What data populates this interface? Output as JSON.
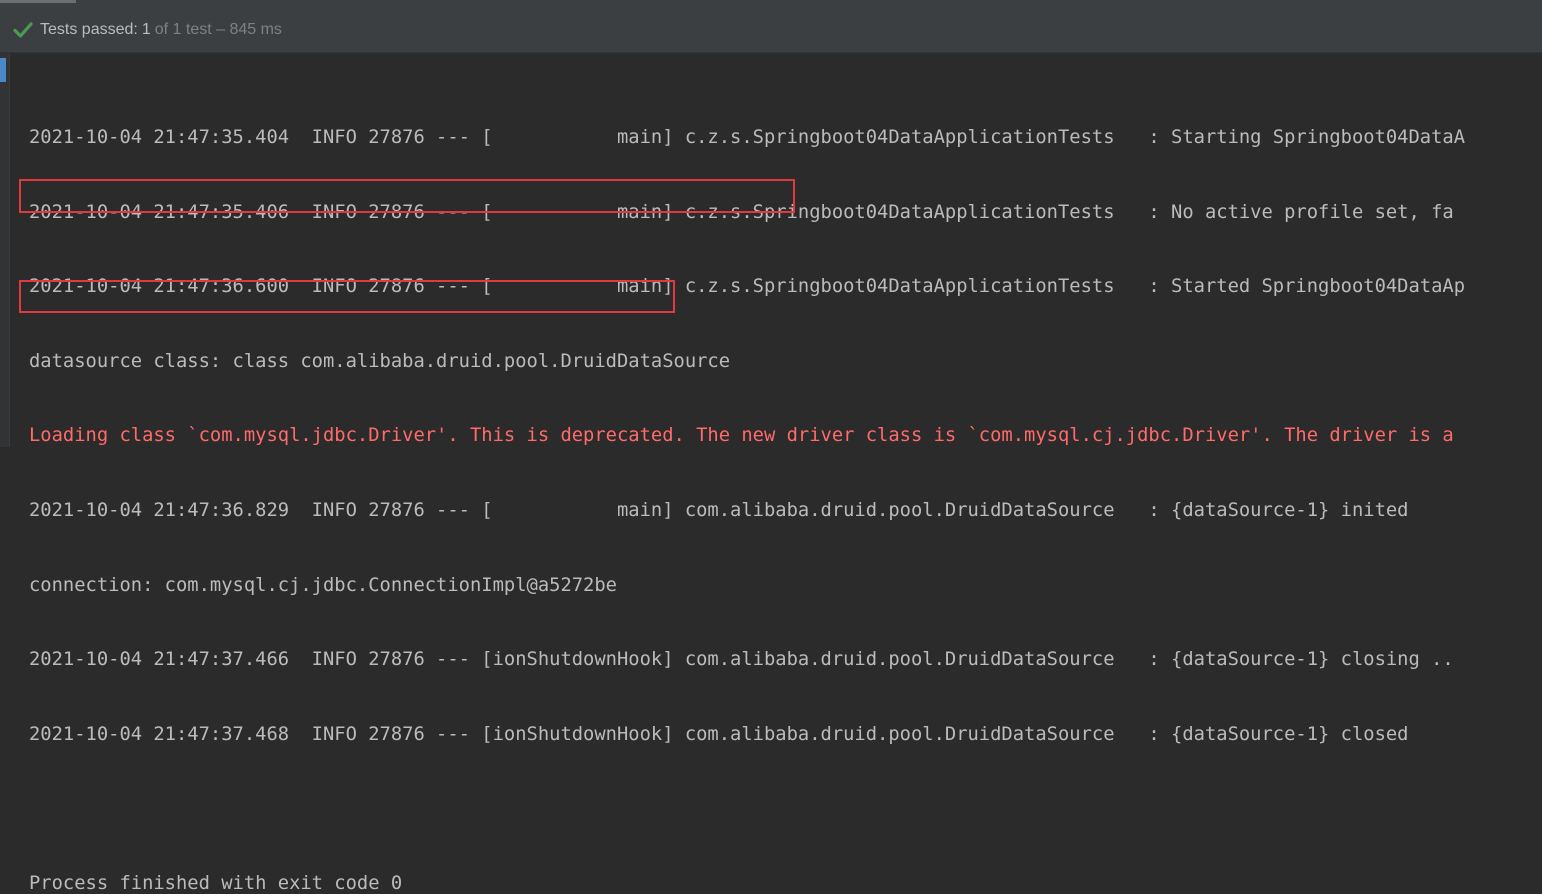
{
  "status": {
    "label": "Tests passed:",
    "passed": "1",
    "rest": "of 1 test – 845 ms",
    "accent_color": "#499c54"
  },
  "console": {
    "lines": [
      {
        "text": "2021-10-04 21:47:35.404  INFO 27876 --- [           main] c.z.s.Springboot04DataApplicationTests   : Starting Springboot04DataA",
        "kind": "log"
      },
      {
        "text": "2021-10-04 21:47:35.406  INFO 27876 --- [           main] c.z.s.Springboot04DataApplicationTests   : No active profile set, fa",
        "kind": "log"
      },
      {
        "text": "2021-10-04 21:47:36.600  INFO 27876 --- [           main] c.z.s.Springboot04DataApplicationTests   : Started Springboot04DataAp",
        "kind": "log"
      },
      {
        "text": "datasource class: class com.alibaba.druid.pool.DruidDataSource",
        "kind": "highlight"
      },
      {
        "text": "Loading class `com.mysql.jdbc.Driver'. This is deprecated. The new driver class is `com.mysql.cj.jdbc.Driver'. The driver is a",
        "kind": "error"
      },
      {
        "text": "2021-10-04 21:47:36.829  INFO 27876 --- [           main] com.alibaba.druid.pool.DruidDataSource   : {dataSource-1} inited",
        "kind": "log"
      },
      {
        "text": "connection: com.mysql.cj.jdbc.ConnectionImpl@a5272be",
        "kind": "highlight"
      },
      {
        "text": "2021-10-04 21:47:37.466  INFO 27876 --- [ionShutdownHook] com.alibaba.druid.pool.DruidDataSource   : {dataSource-1} closing ..",
        "kind": "log"
      },
      {
        "text": "2021-10-04 21:47:37.468  INFO 27876 --- [ionShutdownHook] com.alibaba.druid.pool.DruidDataSource   : {dataSource-1} closed",
        "kind": "log"
      },
      {
        "text": "",
        "kind": "blank"
      },
      {
        "text": "Process finished with exit code 0",
        "kind": "log"
      }
    ]
  },
  "colors": {
    "background": "#2b2b2b",
    "text": "#bbbbbb",
    "error": "#ff6b68",
    "highlight_border": "#e0393e"
  }
}
